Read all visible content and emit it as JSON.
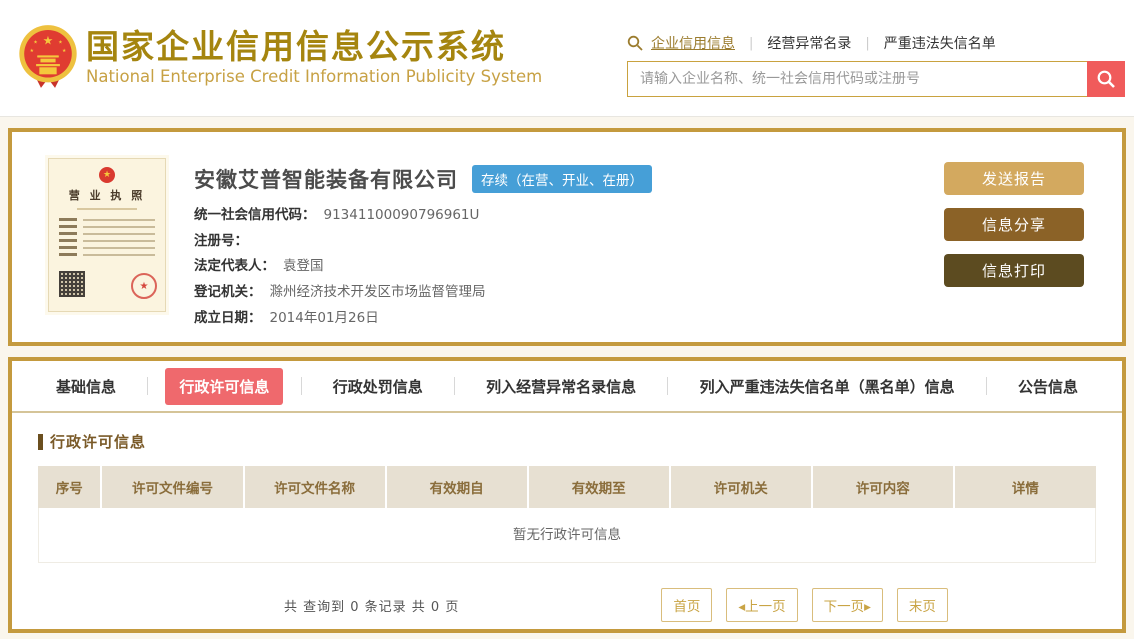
{
  "header": {
    "title_cn": "国家企业信用信息公示系统",
    "title_en": "National Enterprise Credit Information Publicity System",
    "search_tabs": [
      {
        "label": "企业信用信息",
        "active": true
      },
      {
        "label": "经营异常名录",
        "active": false
      },
      {
        "label": "严重违法失信名单",
        "active": false
      }
    ],
    "search_placeholder": "请输入企业名称、统一社会信用代码或注册号"
  },
  "company": {
    "name": "安徽艾普智能装备有限公司",
    "status_badge": "存续（在营、开业、在册）",
    "license_image_title": "营 业 执 照",
    "fields": [
      {
        "label": "统一社会信用代码：",
        "value": "91341100090796961U"
      },
      {
        "label": "注册号：",
        "value": ""
      },
      {
        "label": "法定代表人：",
        "value": "袁登国"
      },
      {
        "label": "登记机关：",
        "value": "滁州经济技术开发区市场监督管理局"
      },
      {
        "label": "成立日期：",
        "value": "2014年01月26日"
      }
    ],
    "actions": [
      {
        "label": "发送报告",
        "color": "#d3a95f"
      },
      {
        "label": "信息分享",
        "color": "#8b6227"
      },
      {
        "label": "信息打印",
        "color": "#5c4b20"
      }
    ]
  },
  "tabs": [
    {
      "label": "基础信息",
      "active": false
    },
    {
      "label": "行政许可信息",
      "active": true
    },
    {
      "label": "行政处罚信息",
      "active": false
    },
    {
      "label": "列入经营异常名录信息",
      "active": false
    },
    {
      "label": "列入严重违法失信名单（黑名单）信息",
      "active": false
    },
    {
      "label": "公告信息",
      "active": false
    }
  ],
  "section": {
    "title": "行政许可信息",
    "table_headers": [
      "序号",
      "许可文件编号",
      "许可文件名称",
      "有效期自",
      "有效期至",
      "许可机关",
      "许可内容",
      "详情"
    ],
    "empty_message": "暂无行政许可信息",
    "record_summary": "共 查询到 0 条记录 共 0 页",
    "pagination": [
      {
        "label": "首页"
      },
      {
        "label": "◂上一页"
      },
      {
        "label": "下一页▸"
      },
      {
        "label": "末页"
      }
    ]
  },
  "colors": {
    "gold_border": "#c49a3e",
    "title_gold": "#a5850f",
    "accent_red": "#f05b5b",
    "active_tab_red": "#ef696d",
    "status_blue": "#469fd7",
    "table_header_bg": "#e7e0d2",
    "table_header_text": "#8a6d3b",
    "page_bg": "#faf6ed"
  }
}
